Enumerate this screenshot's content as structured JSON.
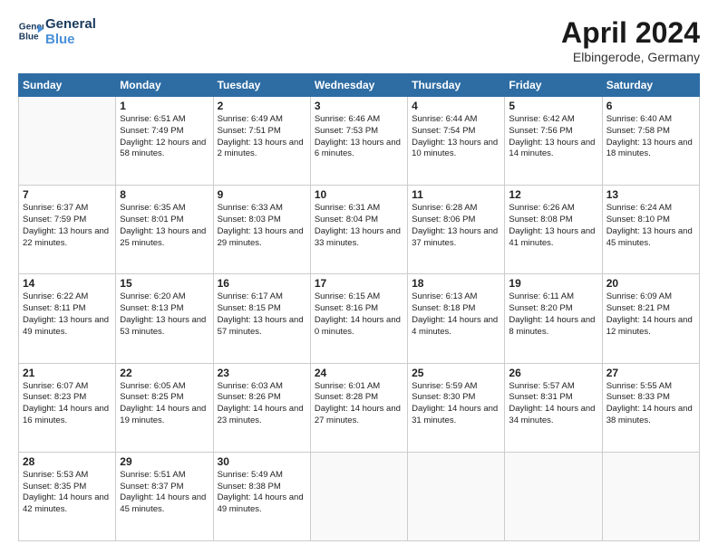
{
  "logo": {
    "line1": "General",
    "line2": "Blue"
  },
  "title": "April 2024",
  "subtitle": "Elbingerode, Germany",
  "days_of_week": [
    "Sunday",
    "Monday",
    "Tuesday",
    "Wednesday",
    "Thursday",
    "Friday",
    "Saturday"
  ],
  "weeks": [
    [
      {
        "day": "",
        "sunrise": "",
        "sunset": "",
        "daylight": ""
      },
      {
        "day": "1",
        "sunrise": "Sunrise: 6:51 AM",
        "sunset": "Sunset: 7:49 PM",
        "daylight": "Daylight: 12 hours and 58 minutes."
      },
      {
        "day": "2",
        "sunrise": "Sunrise: 6:49 AM",
        "sunset": "Sunset: 7:51 PM",
        "daylight": "Daylight: 13 hours and 2 minutes."
      },
      {
        "day": "3",
        "sunrise": "Sunrise: 6:46 AM",
        "sunset": "Sunset: 7:53 PM",
        "daylight": "Daylight: 13 hours and 6 minutes."
      },
      {
        "day": "4",
        "sunrise": "Sunrise: 6:44 AM",
        "sunset": "Sunset: 7:54 PM",
        "daylight": "Daylight: 13 hours and 10 minutes."
      },
      {
        "day": "5",
        "sunrise": "Sunrise: 6:42 AM",
        "sunset": "Sunset: 7:56 PM",
        "daylight": "Daylight: 13 hours and 14 minutes."
      },
      {
        "day": "6",
        "sunrise": "Sunrise: 6:40 AM",
        "sunset": "Sunset: 7:58 PM",
        "daylight": "Daylight: 13 hours and 18 minutes."
      }
    ],
    [
      {
        "day": "7",
        "sunrise": "Sunrise: 6:37 AM",
        "sunset": "Sunset: 7:59 PM",
        "daylight": "Daylight: 13 hours and 22 minutes."
      },
      {
        "day": "8",
        "sunrise": "Sunrise: 6:35 AM",
        "sunset": "Sunset: 8:01 PM",
        "daylight": "Daylight: 13 hours and 25 minutes."
      },
      {
        "day": "9",
        "sunrise": "Sunrise: 6:33 AM",
        "sunset": "Sunset: 8:03 PM",
        "daylight": "Daylight: 13 hours and 29 minutes."
      },
      {
        "day": "10",
        "sunrise": "Sunrise: 6:31 AM",
        "sunset": "Sunset: 8:04 PM",
        "daylight": "Daylight: 13 hours and 33 minutes."
      },
      {
        "day": "11",
        "sunrise": "Sunrise: 6:28 AM",
        "sunset": "Sunset: 8:06 PM",
        "daylight": "Daylight: 13 hours and 37 minutes."
      },
      {
        "day": "12",
        "sunrise": "Sunrise: 6:26 AM",
        "sunset": "Sunset: 8:08 PM",
        "daylight": "Daylight: 13 hours and 41 minutes."
      },
      {
        "day": "13",
        "sunrise": "Sunrise: 6:24 AM",
        "sunset": "Sunset: 8:10 PM",
        "daylight": "Daylight: 13 hours and 45 minutes."
      }
    ],
    [
      {
        "day": "14",
        "sunrise": "Sunrise: 6:22 AM",
        "sunset": "Sunset: 8:11 PM",
        "daylight": "Daylight: 13 hours and 49 minutes."
      },
      {
        "day": "15",
        "sunrise": "Sunrise: 6:20 AM",
        "sunset": "Sunset: 8:13 PM",
        "daylight": "Daylight: 13 hours and 53 minutes."
      },
      {
        "day": "16",
        "sunrise": "Sunrise: 6:17 AM",
        "sunset": "Sunset: 8:15 PM",
        "daylight": "Daylight: 13 hours and 57 minutes."
      },
      {
        "day": "17",
        "sunrise": "Sunrise: 6:15 AM",
        "sunset": "Sunset: 8:16 PM",
        "daylight": "Daylight: 14 hours and 0 minutes."
      },
      {
        "day": "18",
        "sunrise": "Sunrise: 6:13 AM",
        "sunset": "Sunset: 8:18 PM",
        "daylight": "Daylight: 14 hours and 4 minutes."
      },
      {
        "day": "19",
        "sunrise": "Sunrise: 6:11 AM",
        "sunset": "Sunset: 8:20 PM",
        "daylight": "Daylight: 14 hours and 8 minutes."
      },
      {
        "day": "20",
        "sunrise": "Sunrise: 6:09 AM",
        "sunset": "Sunset: 8:21 PM",
        "daylight": "Daylight: 14 hours and 12 minutes."
      }
    ],
    [
      {
        "day": "21",
        "sunrise": "Sunrise: 6:07 AM",
        "sunset": "Sunset: 8:23 PM",
        "daylight": "Daylight: 14 hours and 16 minutes."
      },
      {
        "day": "22",
        "sunrise": "Sunrise: 6:05 AM",
        "sunset": "Sunset: 8:25 PM",
        "daylight": "Daylight: 14 hours and 19 minutes."
      },
      {
        "day": "23",
        "sunrise": "Sunrise: 6:03 AM",
        "sunset": "Sunset: 8:26 PM",
        "daylight": "Daylight: 14 hours and 23 minutes."
      },
      {
        "day": "24",
        "sunrise": "Sunrise: 6:01 AM",
        "sunset": "Sunset: 8:28 PM",
        "daylight": "Daylight: 14 hours and 27 minutes."
      },
      {
        "day": "25",
        "sunrise": "Sunrise: 5:59 AM",
        "sunset": "Sunset: 8:30 PM",
        "daylight": "Daylight: 14 hours and 31 minutes."
      },
      {
        "day": "26",
        "sunrise": "Sunrise: 5:57 AM",
        "sunset": "Sunset: 8:31 PM",
        "daylight": "Daylight: 14 hours and 34 minutes."
      },
      {
        "day": "27",
        "sunrise": "Sunrise: 5:55 AM",
        "sunset": "Sunset: 8:33 PM",
        "daylight": "Daylight: 14 hours and 38 minutes."
      }
    ],
    [
      {
        "day": "28",
        "sunrise": "Sunrise: 5:53 AM",
        "sunset": "Sunset: 8:35 PM",
        "daylight": "Daylight: 14 hours and 42 minutes."
      },
      {
        "day": "29",
        "sunrise": "Sunrise: 5:51 AM",
        "sunset": "Sunset: 8:37 PM",
        "daylight": "Daylight: 14 hours and 45 minutes."
      },
      {
        "day": "30",
        "sunrise": "Sunrise: 5:49 AM",
        "sunset": "Sunset: 8:38 PM",
        "daylight": "Daylight: 14 hours and 49 minutes."
      },
      {
        "day": "",
        "sunrise": "",
        "sunset": "",
        "daylight": ""
      },
      {
        "day": "",
        "sunrise": "",
        "sunset": "",
        "daylight": ""
      },
      {
        "day": "",
        "sunrise": "",
        "sunset": "",
        "daylight": ""
      },
      {
        "day": "",
        "sunrise": "",
        "sunset": "",
        "daylight": ""
      }
    ]
  ]
}
